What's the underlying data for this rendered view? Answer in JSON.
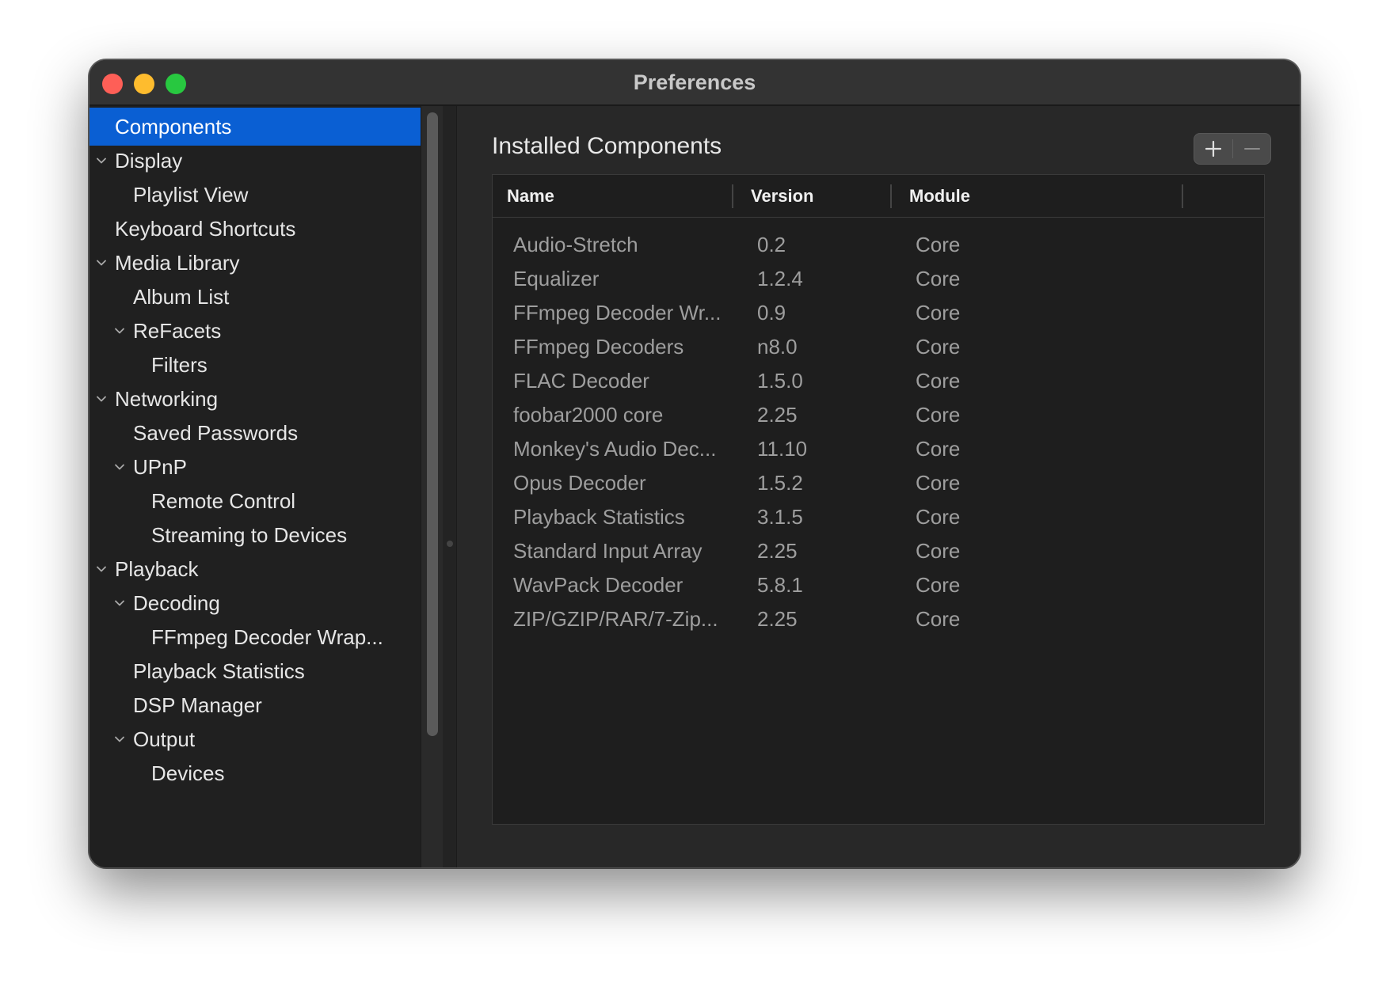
{
  "window": {
    "title": "Preferences"
  },
  "sidebar": {
    "items": [
      {
        "label": "Components",
        "selected": true,
        "expanded": null
      },
      {
        "label": "Display",
        "expanded": true
      },
      {
        "label": "Playlist View",
        "expanded": null
      },
      {
        "label": "Keyboard Shortcuts",
        "expanded": null
      },
      {
        "label": "Media Library",
        "expanded": true
      },
      {
        "label": "Album List",
        "expanded": null
      },
      {
        "label": "ReFacets",
        "expanded": true
      },
      {
        "label": "Filters",
        "expanded": null
      },
      {
        "label": "Networking",
        "expanded": true
      },
      {
        "label": "Saved Passwords",
        "expanded": null
      },
      {
        "label": "UPnP",
        "expanded": true
      },
      {
        "label": "Remote Control",
        "expanded": null
      },
      {
        "label": "Streaming to Devices",
        "expanded": null
      },
      {
        "label": "Playback",
        "expanded": true
      },
      {
        "label": "Decoding",
        "expanded": true
      },
      {
        "label": "FFmpeg Decoder Wrap...",
        "expanded": null
      },
      {
        "label": "Playback Statistics",
        "expanded": null
      },
      {
        "label": "DSP Manager",
        "expanded": null
      },
      {
        "label": "Output",
        "expanded": true
      },
      {
        "label": "Devices",
        "expanded": null
      }
    ]
  },
  "main": {
    "section_title": "Installed Components",
    "buttons": {
      "add": "plus-icon",
      "remove": "minus-icon"
    },
    "table": {
      "columns": [
        "Name",
        "Version",
        "Module"
      ],
      "rows": [
        [
          "Audio-Stretch",
          "0.2",
          "Core"
        ],
        [
          "Equalizer",
          "1.2.4",
          "Core"
        ],
        [
          "FFmpeg Decoder Wr...",
          "0.9",
          "Core"
        ],
        [
          "FFmpeg Decoders",
          "n8.0",
          "Core"
        ],
        [
          "FLAC Decoder",
          "1.5.0",
          "Core"
        ],
        [
          "foobar2000 core",
          "2.25",
          "Core"
        ],
        [
          "Monkey's Audio Dec...",
          "11.10",
          "Core"
        ],
        [
          "Opus Decoder",
          "1.5.2",
          "Core"
        ],
        [
          "Playback Statistics",
          "3.1.5",
          "Core"
        ],
        [
          "Standard Input Array",
          "2.25",
          "Core"
        ],
        [
          "WavPack Decoder",
          "5.8.1",
          "Core"
        ],
        [
          "ZIP/GZIP/RAR/7-Zip...",
          "2.25",
          "Core"
        ]
      ]
    }
  },
  "colors": {
    "selection": "#0a5fd3",
    "close": "#fe5f57",
    "minimize": "#febc2e",
    "maximize": "#28c840"
  }
}
